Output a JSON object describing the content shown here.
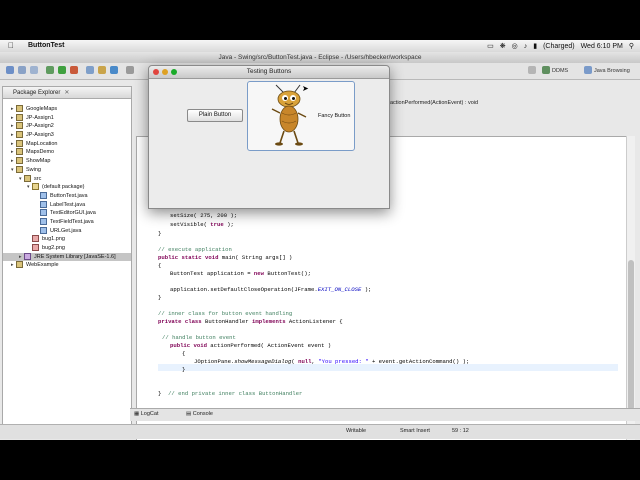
{
  "menubar": {
    "app_name": "ButtonTest",
    "battery": "(Charged)",
    "clock": "Wed 6:10 PM"
  },
  "eclipse": {
    "window_title": "Java - Swing/src/ButtonTest.java - Eclipse - /Users/hbecker/workspace",
    "perspective_ddms": "DDMS",
    "perspective_java": "Java Browsing"
  },
  "package_explorer": {
    "title": "Package Explorer",
    "items": [
      {
        "label": "GoogleMaps",
        "level": 0,
        "icon": "project-icon"
      },
      {
        "label": "JP-Assign1",
        "level": 0,
        "icon": "project-icon"
      },
      {
        "label": "JP-Assign2",
        "level": 0,
        "icon": "project-icon"
      },
      {
        "label": "JP-Assign3",
        "level": 0,
        "icon": "project-icon"
      },
      {
        "label": "MapLocation",
        "level": 0,
        "icon": "project-icon"
      },
      {
        "label": "MapsDemo",
        "level": 0,
        "icon": "project-icon"
      },
      {
        "label": "ShowMap",
        "level": 0,
        "icon": "project-icon"
      },
      {
        "label": "Swing",
        "level": 0,
        "icon": "project-icon",
        "expanded": true
      },
      {
        "label": "src",
        "level": 1,
        "icon": "folder-icon",
        "expanded": true
      },
      {
        "label": "(default package)",
        "level": 2,
        "icon": "package-icon",
        "expanded": true
      },
      {
        "label": "ButtonTest.java",
        "level": 3,
        "icon": "java-file-icon"
      },
      {
        "label": "LabelTest.java",
        "level": 3,
        "icon": "java-file-icon"
      },
      {
        "label": "TextEditorGUI.java",
        "level": 3,
        "icon": "java-file-icon"
      },
      {
        "label": "TextFieldTest.java",
        "level": 3,
        "icon": "java-file-icon"
      },
      {
        "label": "URLGet.java",
        "level": 3,
        "icon": "java-file-icon"
      },
      {
        "label": "bug1.png",
        "level": 2,
        "icon": "image-icon"
      },
      {
        "label": "bug2.png",
        "level": 2,
        "icon": "image-icon"
      },
      {
        "label": "JRE System Library [JavaSE-1.6]",
        "level": 1,
        "icon": "library-icon",
        "selected": true
      },
      {
        "label": "WebExample",
        "level": 0,
        "icon": "project-icon"
      }
    ]
  },
  "editor": {
    "breadcrumb": "actionPerformed(ActionEvent) : void"
  },
  "dialog": {
    "title": "Testing Buttons",
    "plain_button": "Plain Button",
    "fancy_button": "Fancy Button"
  },
  "bottom_tabs": {
    "logcat": "LogCat",
    "console": "Console"
  },
  "status": {
    "writable": "Writable",
    "insert_mode": "Smart Insert",
    "position": "59 : 12"
  },
  "colors": {
    "keyword": "#7f0055",
    "comment": "#3f7f5f",
    "string": "#2a00ff"
  }
}
